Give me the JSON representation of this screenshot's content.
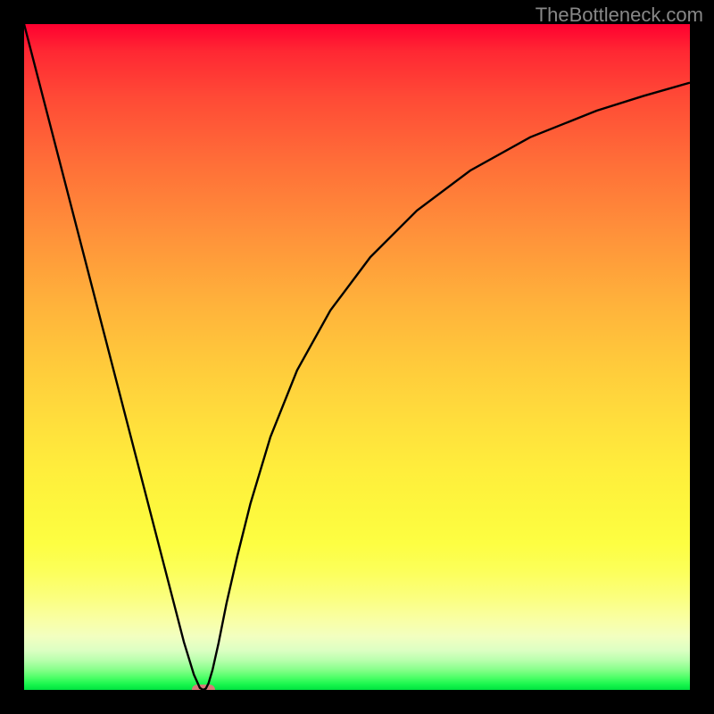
{
  "watermark": "TheBottleneck.com",
  "chart_data": {
    "type": "line",
    "x": [
      0.0,
      0.03,
      0.06,
      0.09,
      0.12,
      0.15,
      0.18,
      0.21,
      0.24,
      0.255,
      0.264,
      0.269,
      0.273,
      0.277,
      0.283,
      0.292,
      0.304,
      0.32,
      0.34,
      0.37,
      0.41,
      0.46,
      0.52,
      0.59,
      0.67,
      0.76,
      0.86,
      0.93,
      1.0
    ],
    "y": [
      1.0,
      0.884,
      0.768,
      0.652,
      0.536,
      0.42,
      0.304,
      0.188,
      0.072,
      0.023,
      0.003,
      0.0,
      0.002,
      0.01,
      0.03,
      0.07,
      0.13,
      0.2,
      0.28,
      0.38,
      0.48,
      0.57,
      0.65,
      0.72,
      0.78,
      0.83,
      0.87,
      0.892,
      0.912
    ],
    "title": "",
    "xlabel": "",
    "ylabel": "",
    "xlim": [
      0,
      1
    ],
    "ylim": [
      0,
      1
    ],
    "marker": {
      "x": 0.27,
      "y": 0.0
    },
    "gradient_stops": [
      {
        "pos": 0.0,
        "color": "#ff0030"
      },
      {
        "pos": 0.5,
        "color": "#ffca3b"
      },
      {
        "pos": 0.8,
        "color": "#fdff50"
      },
      {
        "pos": 0.92,
        "color": "#e8ffc0"
      },
      {
        "pos": 1.0,
        "color": "#00e240"
      }
    ]
  },
  "colors": {
    "frame": "#000000",
    "curve": "#000000",
    "marker": "#d67b78"
  }
}
